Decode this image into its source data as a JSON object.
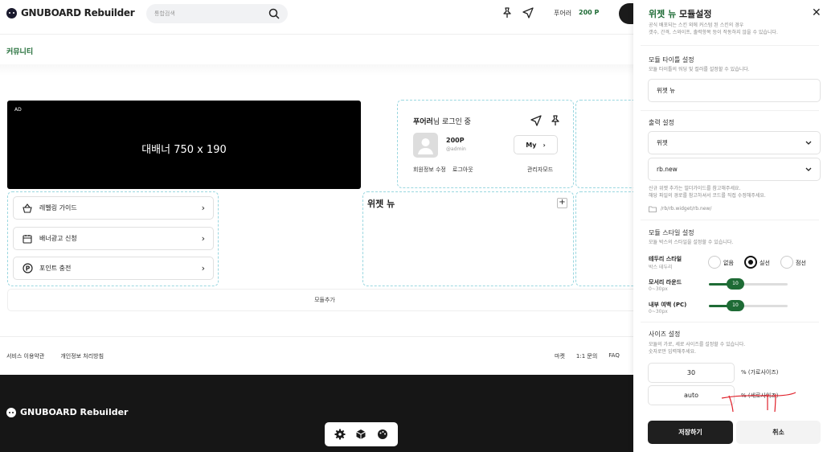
{
  "header": {
    "logo_text": "GNUBOARD Rebuilder",
    "search_placeholder": "통합검색",
    "user_name": "푸어러",
    "user_points": "200 P"
  },
  "subnav": {
    "label": "커뮤니티"
  },
  "banner": {
    "ad_tag": "AD",
    "text": "대배너 750 x 190"
  },
  "login": {
    "name": "푸어러",
    "suffix": "님 로그인 중",
    "points": "200P",
    "user_id": "@admin",
    "my_label": "My",
    "edit_profile": "회원정보 수정",
    "logout": "로그아웃",
    "admin_mode": "관리자모드"
  },
  "guide_buttons": [
    {
      "label": "레벨링 가이드",
      "icon": "basket-icon"
    },
    {
      "label": "배너광고 신청",
      "icon": "calendar-icon"
    },
    {
      "label": "포인트 충전",
      "icon": "point-icon"
    }
  ],
  "widget": {
    "title": "위젯 뉴",
    "add": "+"
  },
  "add_module": "모듈추가",
  "footer": {
    "links_left": [
      "서비스 이용약관",
      "개인정보 처리방침"
    ],
    "links_right": [
      "마켓",
      "1:1 문의",
      "FAQ"
    ],
    "logo_text": "GNUBOARD Rebuilder",
    "toolbar_icons": [
      "gear-icon",
      "cube-icon",
      "palette-icon"
    ]
  },
  "panel": {
    "title_green": "위젯 뉴",
    "title_rest": " 모듈설정",
    "desc1": "공식 배포되는 스킨 외에 커스텀 된 스킨의 경우",
    "desc2": "갯수, 간격, 스와이프, 출력항목 등이 작동하지 않을 수 있습니다.",
    "title_section": {
      "heading": "모듈 타이틀 설정",
      "desc": "모듈 타이틀의 워딩 및 컬러를 설정할 수 있습니다.",
      "value": "위젯 뉴"
    },
    "output_section": {
      "heading": "출력 설정",
      "select1": "위젯",
      "select2": "rb.new",
      "note1": "신규 위젯 추가는 빌더가이드를 참고해주세요.",
      "note2": "해당 파일의 경로를 참고하셔서 코드를 직접 수정해주세요.",
      "path": "/rb/rb.widget/rb.new/"
    },
    "style_section": {
      "heading": "모듈 스타일 설정",
      "desc": "모듈 박스의 스타일을 설정할 수 있습니다.",
      "border_label": "테두리 스타일",
      "border_sub": "박스 테두리",
      "options": [
        "없음",
        "실선",
        "점선"
      ],
      "selected": "실선",
      "radius_label": "모서리 라운드",
      "radius_sub": "0~30px",
      "radius_value": "10",
      "radius_fraction": 0.333,
      "padding_label": "내부 여백 (PC)",
      "padding_sub": "0~30px",
      "padding_value": "10",
      "padding_fraction": 0.333
    },
    "size_section": {
      "heading": "사이즈 설정",
      "desc1": "모듈의 가로, 세로 사이즈를 설정할 수 있습니다.",
      "desc2": "숫자로만 입력해주세요.",
      "width_value": "30",
      "width_label": "% (가로사이즈)",
      "height_value": "auto",
      "height_label": "% (세로사이즈)"
    },
    "save": "저장하기",
    "cancel": "취소"
  },
  "colors": {
    "accent": "#1e6b35",
    "dark": "#161616",
    "dashed": "#9ad7e0",
    "annotation": "#e0202a"
  }
}
